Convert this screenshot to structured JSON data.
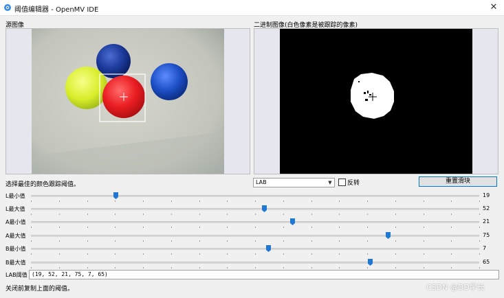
{
  "window": {
    "title": "阈值编辑器 - OpenMV IDE",
    "close_symbol": "✕"
  },
  "source": {
    "label": "源图像"
  },
  "binary": {
    "label": "二进制图像(白色像素是被跟踪的像素)"
  },
  "instruction": "选择最佳的颜色跟踪阈值。",
  "colorspace": {
    "selected": "LAB",
    "arrow": "▼"
  },
  "invert": {
    "label": "反转",
    "checked": false
  },
  "reset_button": "重置滑块",
  "sliders": [
    {
      "label": "L最小值",
      "value": "19",
      "min": 0,
      "max": 100,
      "level": 19
    },
    {
      "label": "L最大值",
      "value": "52",
      "min": 0,
      "max": 100,
      "level": 52
    },
    {
      "label": "A最小值",
      "value": "21",
      "min": -128,
      "max": 127,
      "level": 21
    },
    {
      "label": "A最大值",
      "value": "75",
      "min": -128,
      "max": 127,
      "level": 75
    },
    {
      "label": "B最小值",
      "value": "7",
      "min": -128,
      "max": 127,
      "level": 7
    },
    {
      "label": "B最大值",
      "value": "65",
      "min": -128,
      "max": 127,
      "level": 65
    }
  ],
  "lab_threshold": {
    "label": "LAB阈值",
    "value": "(19, 52, 21, 75, 7, 65)"
  },
  "footer_note": "关闭前复制上面的阈值。",
  "watermark": "CSDN @DD学长",
  "colors": {
    "accent": "#0078d7",
    "thumb": "#1f78d1",
    "panel_bg": "#e6e6ee"
  }
}
